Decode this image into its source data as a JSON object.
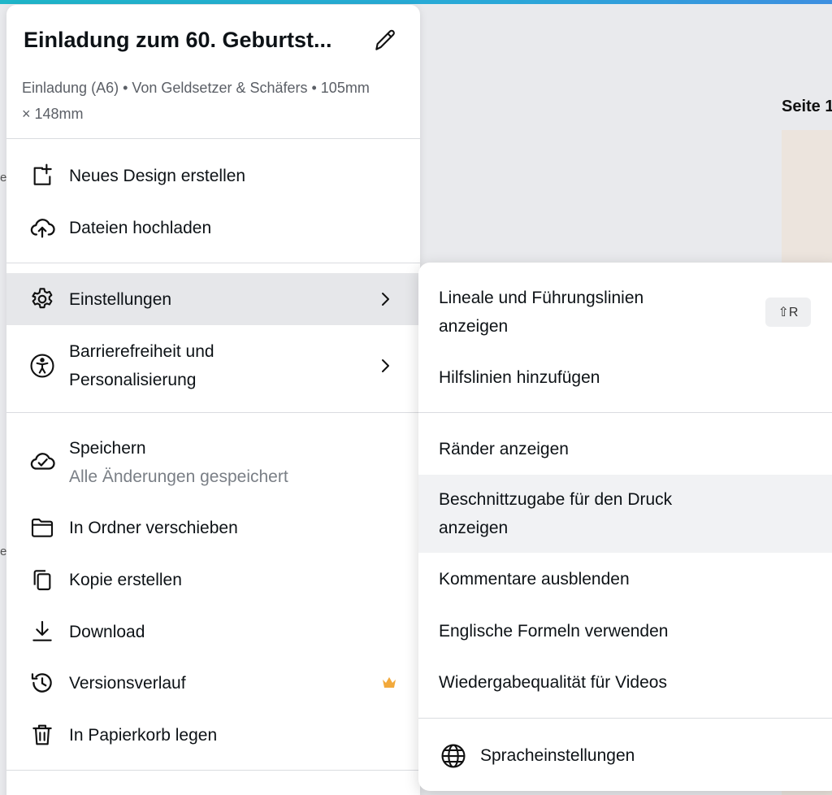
{
  "background": {
    "page_label": "Seite 1",
    "edge_chars": [
      "e",
      "e"
    ]
  },
  "menu": {
    "title": "Einladung zum 60. Geburtst...",
    "meta": "Einladung (A6) • Von Geldsetzer & Schäfers • 105mm × 148mm",
    "items": [
      {
        "label": "Neues Design erstellen",
        "icon": "new-design-icon"
      },
      {
        "label": "Dateien hochladen",
        "icon": "cloud-upload-icon"
      },
      {
        "label": "Einstellungen",
        "icon": "gear-icon"
      },
      {
        "label": "Barrierefreiheit und Personalisierung",
        "icon": "accessibility-icon"
      },
      {
        "label": "Speichern",
        "sublabel": "Alle Änderungen gespeichert",
        "icon": "cloud-check-icon"
      },
      {
        "label": "In Ordner verschieben",
        "icon": "folder-icon"
      },
      {
        "label": "Kopie erstellen",
        "icon": "copy-icon"
      },
      {
        "label": "Download",
        "icon": "download-icon"
      },
      {
        "label": "Versionsverlauf",
        "icon": "history-icon",
        "badge": "crown-icon"
      },
      {
        "label": "In Papierkorb legen",
        "icon": "trash-icon"
      }
    ]
  },
  "submenu": {
    "items": [
      {
        "label": "Lineale und Führungslinien anzeigen",
        "shortcut": "⇧R"
      },
      {
        "label": "Hilfslinien hinzufügen"
      },
      {
        "label": "Ränder anzeigen"
      },
      {
        "label": "Beschnittzugabe für den Druck anzeigen"
      },
      {
        "label": "Kommentare ausblenden"
      },
      {
        "label": "Englische Formeln verwenden"
      },
      {
        "label": "Wiedergabequalität für Videos"
      },
      {
        "label": "Spracheinstellungen",
        "icon": "globe-icon"
      }
    ]
  },
  "colors": {
    "accent_strip": "#1fb6c9",
    "highlight": "#e6e7ea",
    "crown": "#f2a93b"
  }
}
